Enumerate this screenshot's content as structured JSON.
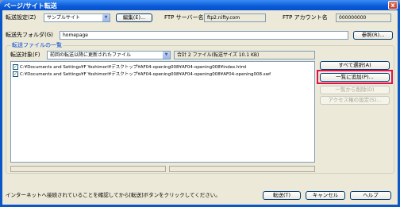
{
  "window": {
    "title": "ページ/サイト転送",
    "close_label": "x"
  },
  "top": {
    "settings_label": "転送設定(Z)",
    "settings_value": "サンプルサイト",
    "edit_button": "編集(E)...",
    "ftp_server_label": "FTP サーバー名",
    "ftp_server_value": "ftp2.nifty.com",
    "ftp_account_label": "FTP アカウント名",
    "ftp_account_value": "000000000",
    "dest_folder_label": "転送先フォルダ(G)",
    "dest_folder_value": "homepage",
    "browse_button": "参照(R)..."
  },
  "files": {
    "group_title": "転送ファイルの一覧",
    "target_label": "転送対象(F)",
    "target_value": "前回の転送以降に更新されたファイル",
    "summary": "合計 2 ファイル(転送サイズ 10.1 KB)",
    "rows": [
      "C:¥Documents and Settings¥F Yoshimori¥デスクトップ¥AF04-opening008¥AF04-opening008¥index.html",
      "C:¥Documents and Settings¥F Yoshimori¥デスクトップ¥AF04-opening008¥AF04-opening008¥AF04-opening008.swf"
    ],
    "select_all_button": "すべて選択(A)",
    "add_button": "一覧に追加(P)...",
    "remove_button": "一覧から削除(D)",
    "access_button": "アクセス権の設定(S)..."
  },
  "footer": {
    "message": "インターネットへ接続されていることを確認してから[転送]ボタンをクリックしてください。",
    "transfer_button": "転送(T)",
    "cancel_button": "キャンセル",
    "help_button": "ヘルプ"
  },
  "colors": {
    "title_bar": "#0b5ad9",
    "highlight": "#e0124e",
    "group_title": "#0046d5"
  }
}
